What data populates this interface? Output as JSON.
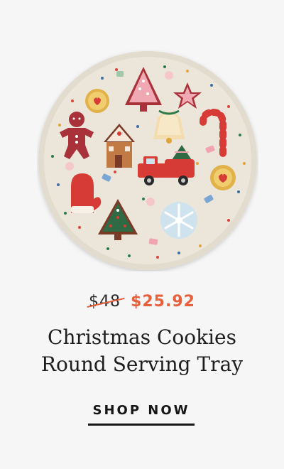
{
  "product": {
    "image_alt": "Christmas Cookies Round Serving Tray",
    "old_price": "$48",
    "new_price": "$25.92",
    "title_line1": "Christmas Cookies",
    "title_line2": "Round Serving Tray",
    "cta_label": "SHOP NOW"
  },
  "colors": {
    "background": "#f6f6f7",
    "sale": "#e5603b",
    "text": "#1e1e1e",
    "tray": "#ece6da"
  }
}
